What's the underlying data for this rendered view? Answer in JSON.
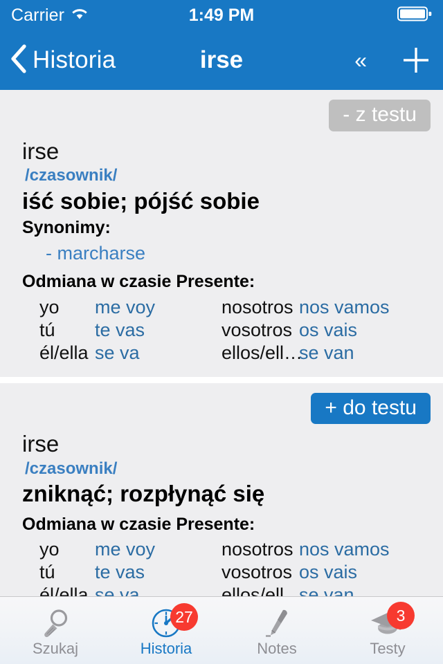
{
  "status_bar": {
    "carrier": "Carrier",
    "wifi_icon": "wifi-icon",
    "time": "1:49 PM",
    "battery_icon": "battery-icon"
  },
  "nav_bar": {
    "back_icon": "chevron-left-icon",
    "back_label": "Historia",
    "title": "irse",
    "collapse_icon": "double-chevron-left-icon",
    "collapse_label": "«",
    "add_icon": "plus-icon"
  },
  "entries": [
    {
      "tag_button": "- z testu",
      "tag_state": "remove",
      "term": "irse",
      "part_of_speech": "/czasownik/",
      "definition": "iść sobie; pójść sobie",
      "synonyms_heading": "Synonimy:",
      "synonyms": [
        "- marcharse"
      ],
      "conjugation_heading": "Odmiana w czasie Presente:",
      "conjugation": [
        {
          "p1": "yo",
          "v1": "me voy",
          "p2": "nosotros",
          "v2": "nos vamos"
        },
        {
          "p1": "tú",
          "v1": "te vas",
          "p2": "vosotros",
          "v2": "os vais"
        },
        {
          "p1": "él/ella",
          "v1": "se va",
          "p2": "ellos/ell…",
          "v2": "se van"
        }
      ]
    },
    {
      "tag_button": "+ do testu",
      "tag_state": "add",
      "term": "irse",
      "part_of_speech": "/czasownik/",
      "definition": "zniknąć; rozpłynąć się",
      "synonyms_heading": "",
      "synonyms": [],
      "conjugation_heading": "Odmiana w czasie Presente:",
      "conjugation": [
        {
          "p1": "yo",
          "v1": "me voy",
          "p2": "nosotros",
          "v2": "nos vamos"
        },
        {
          "p1": "tú",
          "v1": "te vas",
          "p2": "vosotros",
          "v2": "os vais"
        },
        {
          "p1": "él/ella",
          "v1": "se va",
          "p2": "ellos/ell…",
          "v2": "se van"
        }
      ]
    }
  ],
  "tab_bar": {
    "items": [
      {
        "label": "Szukaj",
        "icon": "magnifier-icon",
        "active": false,
        "badge": ""
      },
      {
        "label": "Historia",
        "icon": "clock-icon",
        "active": true,
        "badge": "27"
      },
      {
        "label": "Notes",
        "icon": "pen-icon",
        "active": false,
        "badge": ""
      },
      {
        "label": "Testy",
        "icon": "graduation-cap-icon",
        "active": false,
        "badge": "3"
      }
    ]
  },
  "colors": {
    "brand_blue": "#1878c4",
    "link_blue": "#3a7fc1",
    "card_bg": "#eeeef0",
    "badge_red": "#f73a30",
    "tag_gray": "#bfbfbf",
    "inactive_gray": "#8e8e93"
  }
}
